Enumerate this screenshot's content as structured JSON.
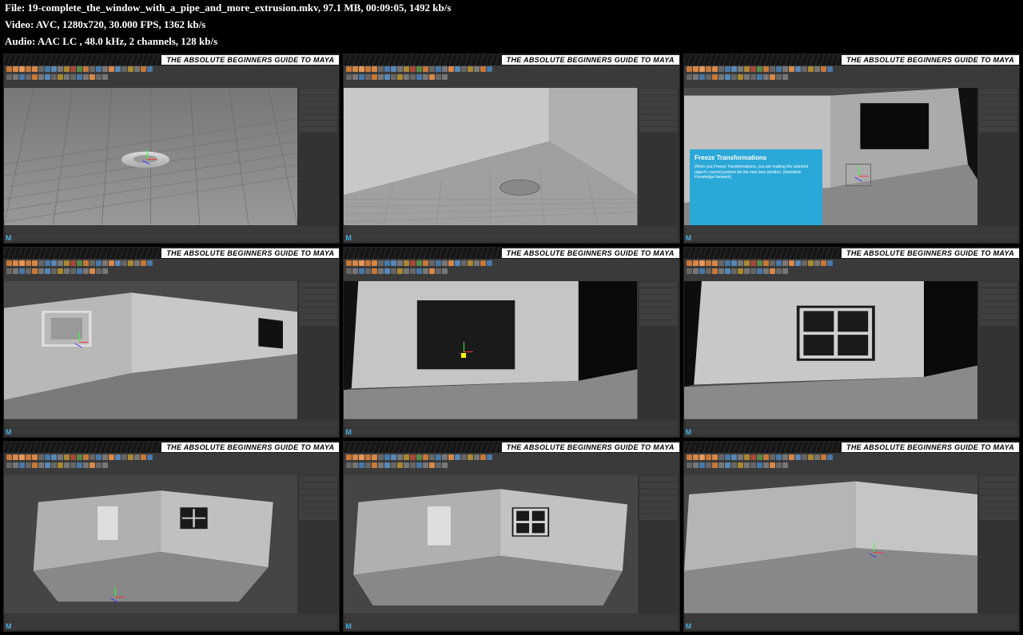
{
  "header": {
    "line1": "File: 19-complete_the_window_with_a_pipe_and_more_extrusion.mkv, 97.1 MB, 00:09:05, 1492 kb/s",
    "line2": "Video: AVC, 1280x720, 30.000 FPS, 1362 kb/s",
    "line3": "Audio: AAC LC , 48.0 kHz, 2 channels, 128 kb/s"
  },
  "thumb_title": "THE ABSOLUTE BEGINNERS GUIDE TO MAYA",
  "maya_logo": "M",
  "info_panel": {
    "title": "Freeze Transformations",
    "body": "When you Freeze Transformations, you are making the selected object's current position be the new zero position. (Autodesk Knowledge Network)"
  },
  "thumbnails": [
    {
      "scene": "cylinder_grid"
    },
    {
      "scene": "floor_object"
    },
    {
      "scene": "room_window_infopanel"
    },
    {
      "scene": "room_corner_window"
    },
    {
      "scene": "wall_window_dark"
    },
    {
      "scene": "wall_window_cross"
    },
    {
      "scene": "room_far_window"
    },
    {
      "scene": "room_front_window"
    },
    {
      "scene": "empty_room_corner"
    }
  ]
}
